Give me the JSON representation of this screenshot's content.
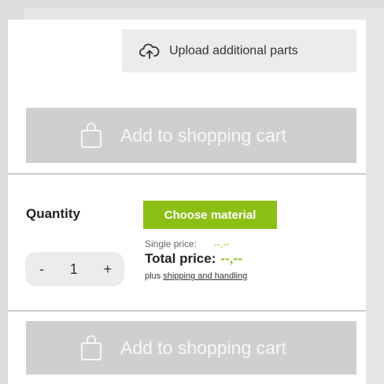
{
  "upload": {
    "label": "Upload additional parts",
    "icon": "cloud-upload-icon"
  },
  "cart_top": {
    "label": "Add to shopping cart",
    "icon": "shopping-bag-icon"
  },
  "cart_bottom": {
    "label": "Add to shopping cart",
    "icon": "shopping-bag-icon"
  },
  "quantity": {
    "label": "Quantity",
    "decrement": "-",
    "value": "1",
    "increment": "+"
  },
  "material": {
    "label": "Choose material"
  },
  "pricing": {
    "single_label": "Single price:",
    "single_value": "--,--",
    "total_label": "Total price:",
    "total_value": "--,--",
    "plus_text": "plus",
    "shipping_link": "shipping and handling"
  },
  "colors": {
    "accent_green": "#8cbf16",
    "disabled_button": "#cfcfcf",
    "secondary_button": "#ececec"
  }
}
